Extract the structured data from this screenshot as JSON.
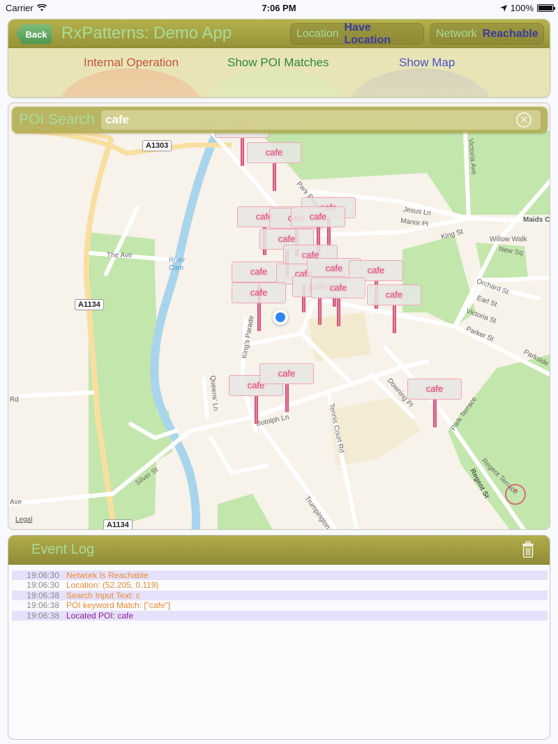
{
  "status_bar": {
    "carrier": "Carrier",
    "time": "7:06 PM",
    "battery": "100%",
    "battery_level": 1.0
  },
  "navbar": {
    "back_label": "Back",
    "title": "RxPatterns: Demo App",
    "location_label": "Location",
    "location_value": "Have Location",
    "network_label": "Network",
    "network_value": "Reachable"
  },
  "modes": {
    "items": [
      {
        "label": "Internal Operation",
        "color": "#c2563a"
      },
      {
        "label": "Show POI Matches",
        "color": "#2d8a3a"
      },
      {
        "label": "Show Map",
        "color": "#4a52c8"
      }
    ],
    "selected_index": 2
  },
  "search": {
    "label": "POI Search",
    "value": "cafe",
    "clear_icon": "clear-circle-icon"
  },
  "map": {
    "pin_label": "cafe",
    "pin_count": 17,
    "road_shields": [
      "A1303",
      "A1134",
      "A1134",
      "A130"
    ],
    "street_labels": [
      "The Ave",
      "River Cam",
      "Victoria Ave",
      "Jesus Ln",
      "Manor Pl",
      "Maids Caus",
      "King St",
      "Willow Walk",
      "New Sq",
      "Orchard St",
      "Earl St",
      "Victoria St",
      "Parker St",
      "Parkside",
      "King's Parade",
      "Queens' Ln",
      "Silver St",
      "Downing Pl",
      "Tennis Court Rd",
      "Trumpington",
      "Regent St",
      "Regent Terrace",
      "Park Terrace",
      "Park Parade",
      "Rd",
      "Ave",
      "Botolph Ln"
    ],
    "legal": "Legal"
  },
  "event_log": {
    "title": "Event Log",
    "entries": [
      {
        "time": "19:06:30",
        "message": "Network Is Reachable"
      },
      {
        "time": "19:06:30",
        "message": "Location: (52.205, 0.119)"
      },
      {
        "time": "19:06:38",
        "message": "Search Input Text: c"
      },
      {
        "time": "19:06:38",
        "message": "POI keyword Match: [\"cafe\"]"
      },
      {
        "time": "19:06:38",
        "message": "Located POI: cafe"
      }
    ]
  }
}
